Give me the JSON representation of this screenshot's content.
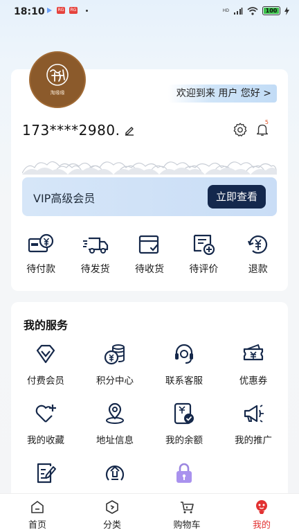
{
  "status_bar": {
    "time": "18:10",
    "app_badges": [
      "RG",
      "RG"
    ],
    "signal_label": "HD",
    "battery": "100",
    "battery_color": "#3cc24a"
  },
  "profile": {
    "avatar_text": "淘缘缘",
    "welcome": "欢迎到来 用户 您好 >",
    "phone": "173****2980.",
    "bell_count": "5",
    "vip_label": "VIP高级会员",
    "vip_button": "立即查看",
    "vip_button_color": "#14284d"
  },
  "orders": [
    {
      "label": "待付款",
      "icon": "wallet-yen-icon"
    },
    {
      "label": "待发货",
      "icon": "delivery-truck-icon"
    },
    {
      "label": "待收货",
      "icon": "package-check-icon"
    },
    {
      "label": "待评价",
      "icon": "review-message-icon"
    },
    {
      "label": "退款",
      "icon": "refund-yen-icon"
    }
  ],
  "services": {
    "title": "我的服务",
    "items": [
      {
        "label": "付费会员",
        "icon": "diamond-icon"
      },
      {
        "label": "积分中心",
        "icon": "coins-icon"
      },
      {
        "label": "联系客服",
        "icon": "headset-icon"
      },
      {
        "label": "优惠券",
        "icon": "coupon-icon"
      },
      {
        "label": "我的收藏",
        "icon": "heart-plus-icon"
      },
      {
        "label": "地址信息",
        "icon": "location-pin-icon"
      },
      {
        "label": "我的余额",
        "icon": "balance-icon"
      },
      {
        "label": "我的推广",
        "icon": "megaphone-icon"
      },
      {
        "label": "",
        "icon": "document-edit-icon"
      },
      {
        "label": "",
        "icon": "upgrade-icon"
      },
      {
        "label": "",
        "icon": "lock-icon"
      }
    ]
  },
  "tabbar": {
    "accent": "#e23131",
    "tabs": [
      {
        "label": "首页",
        "icon": "home-icon"
      },
      {
        "label": "分类",
        "icon": "category-icon"
      },
      {
        "label": "购物车",
        "icon": "cart-icon"
      },
      {
        "label": "我的",
        "icon": "profile-mascot-icon",
        "active": true
      }
    ]
  }
}
